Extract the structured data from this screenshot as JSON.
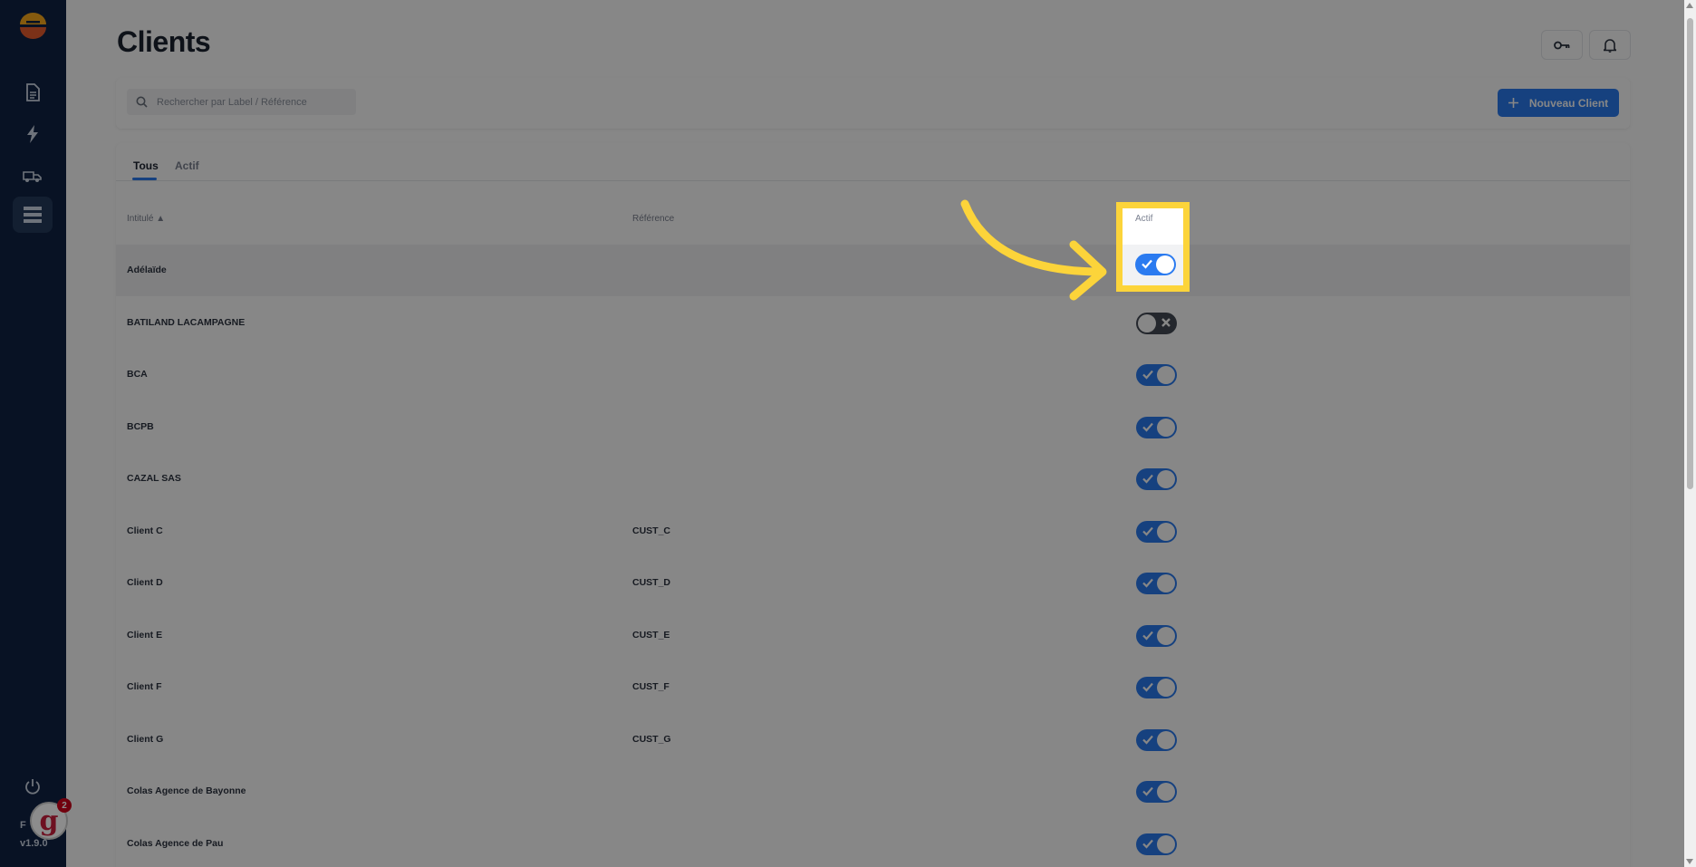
{
  "app": {
    "version_prefix": "F",
    "version": "v1.9.0",
    "notification_count": "2",
    "badge_letter": "g"
  },
  "header": {
    "title": "Clients"
  },
  "search": {
    "placeholder": "Rechercher par Label / Référence"
  },
  "toolbar": {
    "new_client_label": "Nouveau Client"
  },
  "tabs": [
    {
      "label": "Tous",
      "active": true
    },
    {
      "label": "Actif",
      "active": false
    }
  ],
  "table": {
    "columns": [
      "Intitulé ▲",
      "Référence",
      "Actif"
    ],
    "rows": [
      {
        "label": "Adélaïde",
        "reference": "",
        "active": true
      },
      {
        "label": "BATILAND LACAMPAGNE",
        "reference": "",
        "active": false
      },
      {
        "label": "BCA",
        "reference": "",
        "active": true
      },
      {
        "label": "BCPB",
        "reference": "",
        "active": true
      },
      {
        "label": "CAZAL SAS",
        "reference": "",
        "active": true
      },
      {
        "label": "Client C",
        "reference": "CUST_C",
        "active": true
      },
      {
        "label": "Client D",
        "reference": "CUST_D",
        "active": true
      },
      {
        "label": "Client E",
        "reference": "CUST_E",
        "active": true
      },
      {
        "label": "Client F",
        "reference": "CUST_F",
        "active": true
      },
      {
        "label": "Client G",
        "reference": "CUST_G",
        "active": true
      },
      {
        "label": "Colas Agence de Bayonne",
        "reference": "",
        "active": true
      },
      {
        "label": "Colas Agence de Pau",
        "reference": "",
        "active": true
      }
    ]
  },
  "colors": {
    "accent": "#2b7bf0",
    "sidebar": "#0f2242",
    "highlight": "#fcd43a"
  }
}
